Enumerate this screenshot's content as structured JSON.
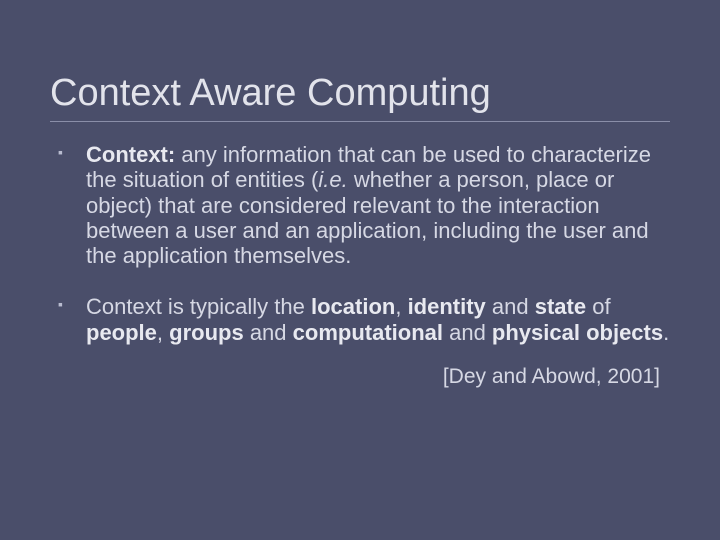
{
  "title": "Context Aware Computing",
  "bullet1": {
    "lead": "Context:",
    "rest": " any information that can be used to characterize the situation of entities (",
    "italic": "i.e.",
    "rest2": " whether a person, place or object) that are considered relevant to the interaction between a user and an application, including the user and the application themselves."
  },
  "bullet2": {
    "p1": "Context is typically the ",
    "b1": "location",
    "p2": ", ",
    "b2": "identity",
    "p3": " and ",
    "b3": "state",
    "p4": " of ",
    "b4": "people",
    "p5": ", ",
    "b5": "groups",
    "p6": " and ",
    "b6": "computational",
    "p7": " and ",
    "b7": "physical objects",
    "p8": "."
  },
  "citation": "[Dey and Abowd, 2001]"
}
